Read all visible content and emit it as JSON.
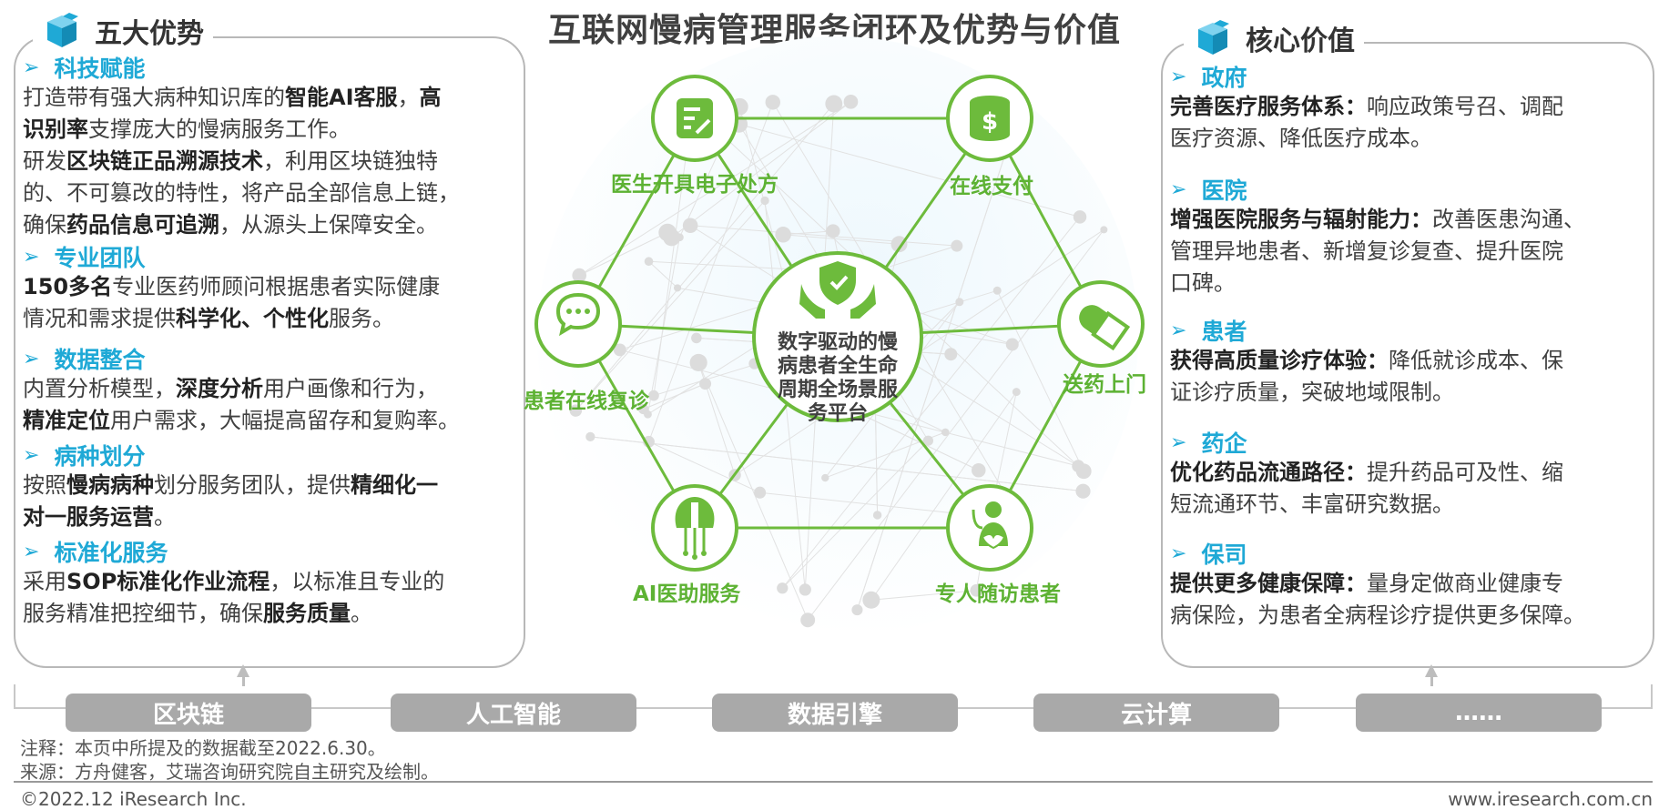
{
  "title": "互联网慢病管理服务闭环及优势与价值",
  "left_panel": {
    "header": "五大优势",
    "sections": [
      {
        "title": "科技赋能",
        "lines": [
          [
            {
              "t": "打造带有强大病种知识库的"
            },
            {
              "t": "智能AI客服",
              "b": true
            },
            {
              "t": "，"
            },
            {
              "t": "高",
              "b": true
            }
          ],
          [
            {
              "t": "识别率",
              "b": true
            },
            {
              "t": "支撑庞大的慢病服务工作。"
            }
          ],
          [
            {
              "t": "研发"
            },
            {
              "t": "区块链正品溯源技术",
              "b": true
            },
            {
              "t": "，利用区块链独特"
            }
          ],
          [
            {
              "t": "的、不可篡改的特性，将产品全部信息上链，"
            }
          ],
          [
            {
              "t": "确保"
            },
            {
              "t": "药品信息可追溯",
              "b": true
            },
            {
              "t": "，从源头上保障安全。"
            }
          ]
        ]
      },
      {
        "title": "专业团队",
        "lines": [
          [
            {
              "t": "150多名",
              "b": true
            },
            {
              "t": "专业医药师顾问根据患者实际健康"
            }
          ],
          [
            {
              "t": "情况和需求提供"
            },
            {
              "t": "科学化、个性化",
              "b": true
            },
            {
              "t": "服务。"
            }
          ]
        ]
      },
      {
        "title": "数据整合",
        "lines": [
          [
            {
              "t": "内置分析模型，"
            },
            {
              "t": "深度分析",
              "b": true
            },
            {
              "t": "用户画像和行为，"
            }
          ],
          [
            {
              "t": "精准定位",
              "b": true
            },
            {
              "t": "用户需求，大幅提高留存和复购率。"
            }
          ]
        ]
      },
      {
        "title": "病种划分",
        "lines": [
          [
            {
              "t": "按照"
            },
            {
              "t": "慢病病种",
              "b": true
            },
            {
              "t": "划分服务团队，提供"
            },
            {
              "t": "精细化一",
              "b": true
            }
          ],
          [
            {
              "t": "对一服务运营",
              "b": true
            },
            {
              "t": "。"
            }
          ]
        ]
      },
      {
        "title": "标准化服务",
        "lines": [
          [
            {
              "t": "采用"
            },
            {
              "t": "SOP标准化作业流程",
              "b": true
            },
            {
              "t": "，以标准且专业的"
            }
          ],
          [
            {
              "t": "服务精准把控细节，确保"
            },
            {
              "t": "服务质量",
              "b": true
            },
            {
              "t": "。"
            }
          ]
        ]
      }
    ]
  },
  "right_panel": {
    "header": "核心价值",
    "sections": [
      {
        "title": "政府",
        "lines": [
          [
            {
              "t": "完善医疗服务体系：",
              "b": true
            },
            {
              "t": "响应政策号召、调配"
            }
          ],
          [
            {
              "t": "医疗资源、降低医疗成本。"
            }
          ]
        ]
      },
      {
        "title": "医院",
        "lines": [
          [
            {
              "t": "增强医院服务与辐射能力：",
              "b": true
            },
            {
              "t": "改善医患沟通、"
            }
          ],
          [
            {
              "t": "管理异地患者、新增复诊复查、提升医院"
            }
          ],
          [
            {
              "t": "口碑。"
            }
          ]
        ]
      },
      {
        "title": "患者",
        "lines": [
          [
            {
              "t": "获得高质量诊疗体验：",
              "b": true
            },
            {
              "t": "降低就诊成本、保"
            }
          ],
          [
            {
              "t": "证诊疗质量，突破地域限制。"
            }
          ]
        ]
      },
      {
        "title": "药企",
        "lines": [
          [
            {
              "t": "优化药品流通路径：",
              "b": true
            },
            {
              "t": "提升药品可及性、缩"
            }
          ],
          [
            {
              "t": "短流通环节、丰富研究数据。"
            }
          ]
        ]
      },
      {
        "title": "保司",
        "lines": [
          [
            {
              "t": "提供更多健康保障：",
              "b": true
            },
            {
              "t": "量身定做商业健康专"
            }
          ],
          [
            {
              "t": "病保险，为患者全病程诊疗提供更多保障。"
            }
          ]
        ]
      }
    ]
  },
  "diagram": {
    "center_lines": [
      "数字驱动的慢",
      "病患者全生命",
      "周期全场景服",
      "务平台"
    ],
    "nodes": [
      {
        "label": "医生开具电子处方",
        "icon": "prescription-icon"
      },
      {
        "label": "在线支付",
        "icon": "coins-icon"
      },
      {
        "label": "送药上门",
        "icon": "pill-icon"
      },
      {
        "label": "专人随访患者",
        "icon": "doctor-icon"
      },
      {
        "label": "AI医助服务",
        "icon": "ai-brain-icon"
      },
      {
        "label": "患者在线复诊",
        "icon": "chat-icon"
      }
    ],
    "accent_color": "#6dbb3c",
    "center_icon": "hands-shield-icon"
  },
  "tech_bar": [
    "区块链",
    "人工智能",
    "数据引擎",
    "云计算",
    "……"
  ],
  "notes": {
    "note": "注释：本页中所提及的数据截至2022.6.30。",
    "source": "来源：方舟健客，艾瑞咨询研究院自主研究及绘制。"
  },
  "footer": {
    "copyright": "©2022.12 iResearch Inc.",
    "website": "www.iresearch.com.cn"
  }
}
